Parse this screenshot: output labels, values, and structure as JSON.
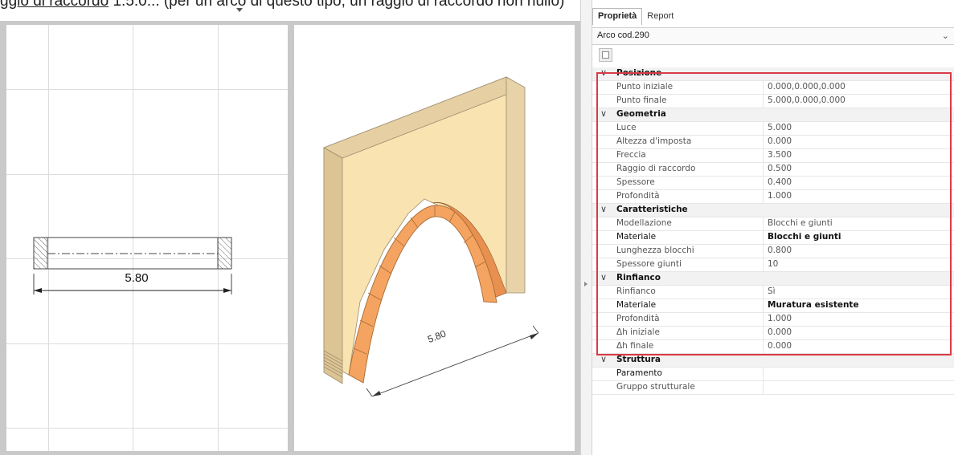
{
  "header": {
    "line_part1": "ggio di raccordo",
    "line_part2": " 1.5.0... (per un arco di questo tipo, un raggio di raccordo non nullo)"
  },
  "views": {
    "plan": {
      "dimension_label": "5.80"
    },
    "iso": {
      "dimension_label": "5.80"
    }
  },
  "panel": {
    "tabs": [
      {
        "label": "Proprietà",
        "active": true
      },
      {
        "label": "Report",
        "active": false
      }
    ],
    "selector": {
      "value": "Arco cod.290",
      "icon": "chevron-down-icon"
    },
    "toolbar": {
      "icon": "properties-toggle-icon"
    },
    "rows": [
      {
        "type": "category",
        "label": "Posizione"
      },
      {
        "type": "prop",
        "label": "Punto iniziale",
        "value": "0.000,0.000,0.000"
      },
      {
        "type": "prop",
        "label": "Punto finale",
        "value": "5.000,0.000,0.000"
      },
      {
        "type": "category",
        "label": "Geometria"
      },
      {
        "type": "prop",
        "label": "Luce",
        "value": "5.000"
      },
      {
        "type": "prop",
        "label": "Altezza d'imposta",
        "value": "0.000"
      },
      {
        "type": "prop",
        "label": "Freccia",
        "value": "3.500"
      },
      {
        "type": "prop",
        "label": "Raggio di raccordo",
        "value": "0.500"
      },
      {
        "type": "prop",
        "label": "Spessore",
        "value": "0.400"
      },
      {
        "type": "prop",
        "label": "Profondità",
        "value": "1.000"
      },
      {
        "type": "category",
        "label": "Caratteristiche"
      },
      {
        "type": "prop",
        "label": "Modellazione",
        "value": "Blocchi e giunti"
      },
      {
        "type": "prop",
        "label": "Materiale",
        "value": "Blocchi e giunti",
        "strong": true
      },
      {
        "type": "prop",
        "label": "Lunghezza blocchi",
        "value": "0.800"
      },
      {
        "type": "prop",
        "label": "Spessore giunti",
        "value": "10"
      },
      {
        "type": "category",
        "label": "Rinfianco"
      },
      {
        "type": "prop",
        "label": "Rinfianco",
        "value": "Sì"
      },
      {
        "type": "prop",
        "label": "Materiale",
        "value": "Muratura esistente",
        "strong": true
      },
      {
        "type": "prop",
        "label": "Profondità",
        "value": "1.000"
      },
      {
        "type": "prop",
        "label": "Δh iniziale",
        "value": "0.000"
      },
      {
        "type": "prop",
        "label": "Δh finale",
        "value": "0.000"
      },
      {
        "type": "category",
        "label": "Struttura"
      },
      {
        "type": "prop",
        "label": "Paramento",
        "value": "",
        "strong": true
      },
      {
        "type": "prop",
        "label": "Gruppo strutturale",
        "value": ""
      }
    ]
  },
  "colors": {
    "wall": "#f9e3b1",
    "wall_top": "#e6cfa2",
    "wall_side": "#dcc494",
    "arch_block": "#f4a460",
    "highlight_border": "#d93a45"
  }
}
